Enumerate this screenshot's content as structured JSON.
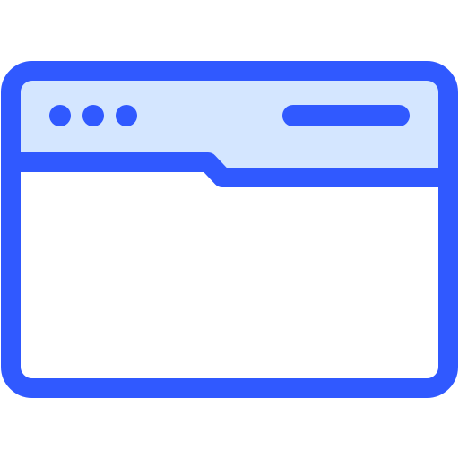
{
  "icon": {
    "name": "browser-window-icon",
    "colors": {
      "stroke": "#3059FF",
      "titlebar_fill": "#D4E6FF",
      "content_fill": "#FFFFFF"
    },
    "titlebar": {
      "dot_count": 3
    }
  }
}
